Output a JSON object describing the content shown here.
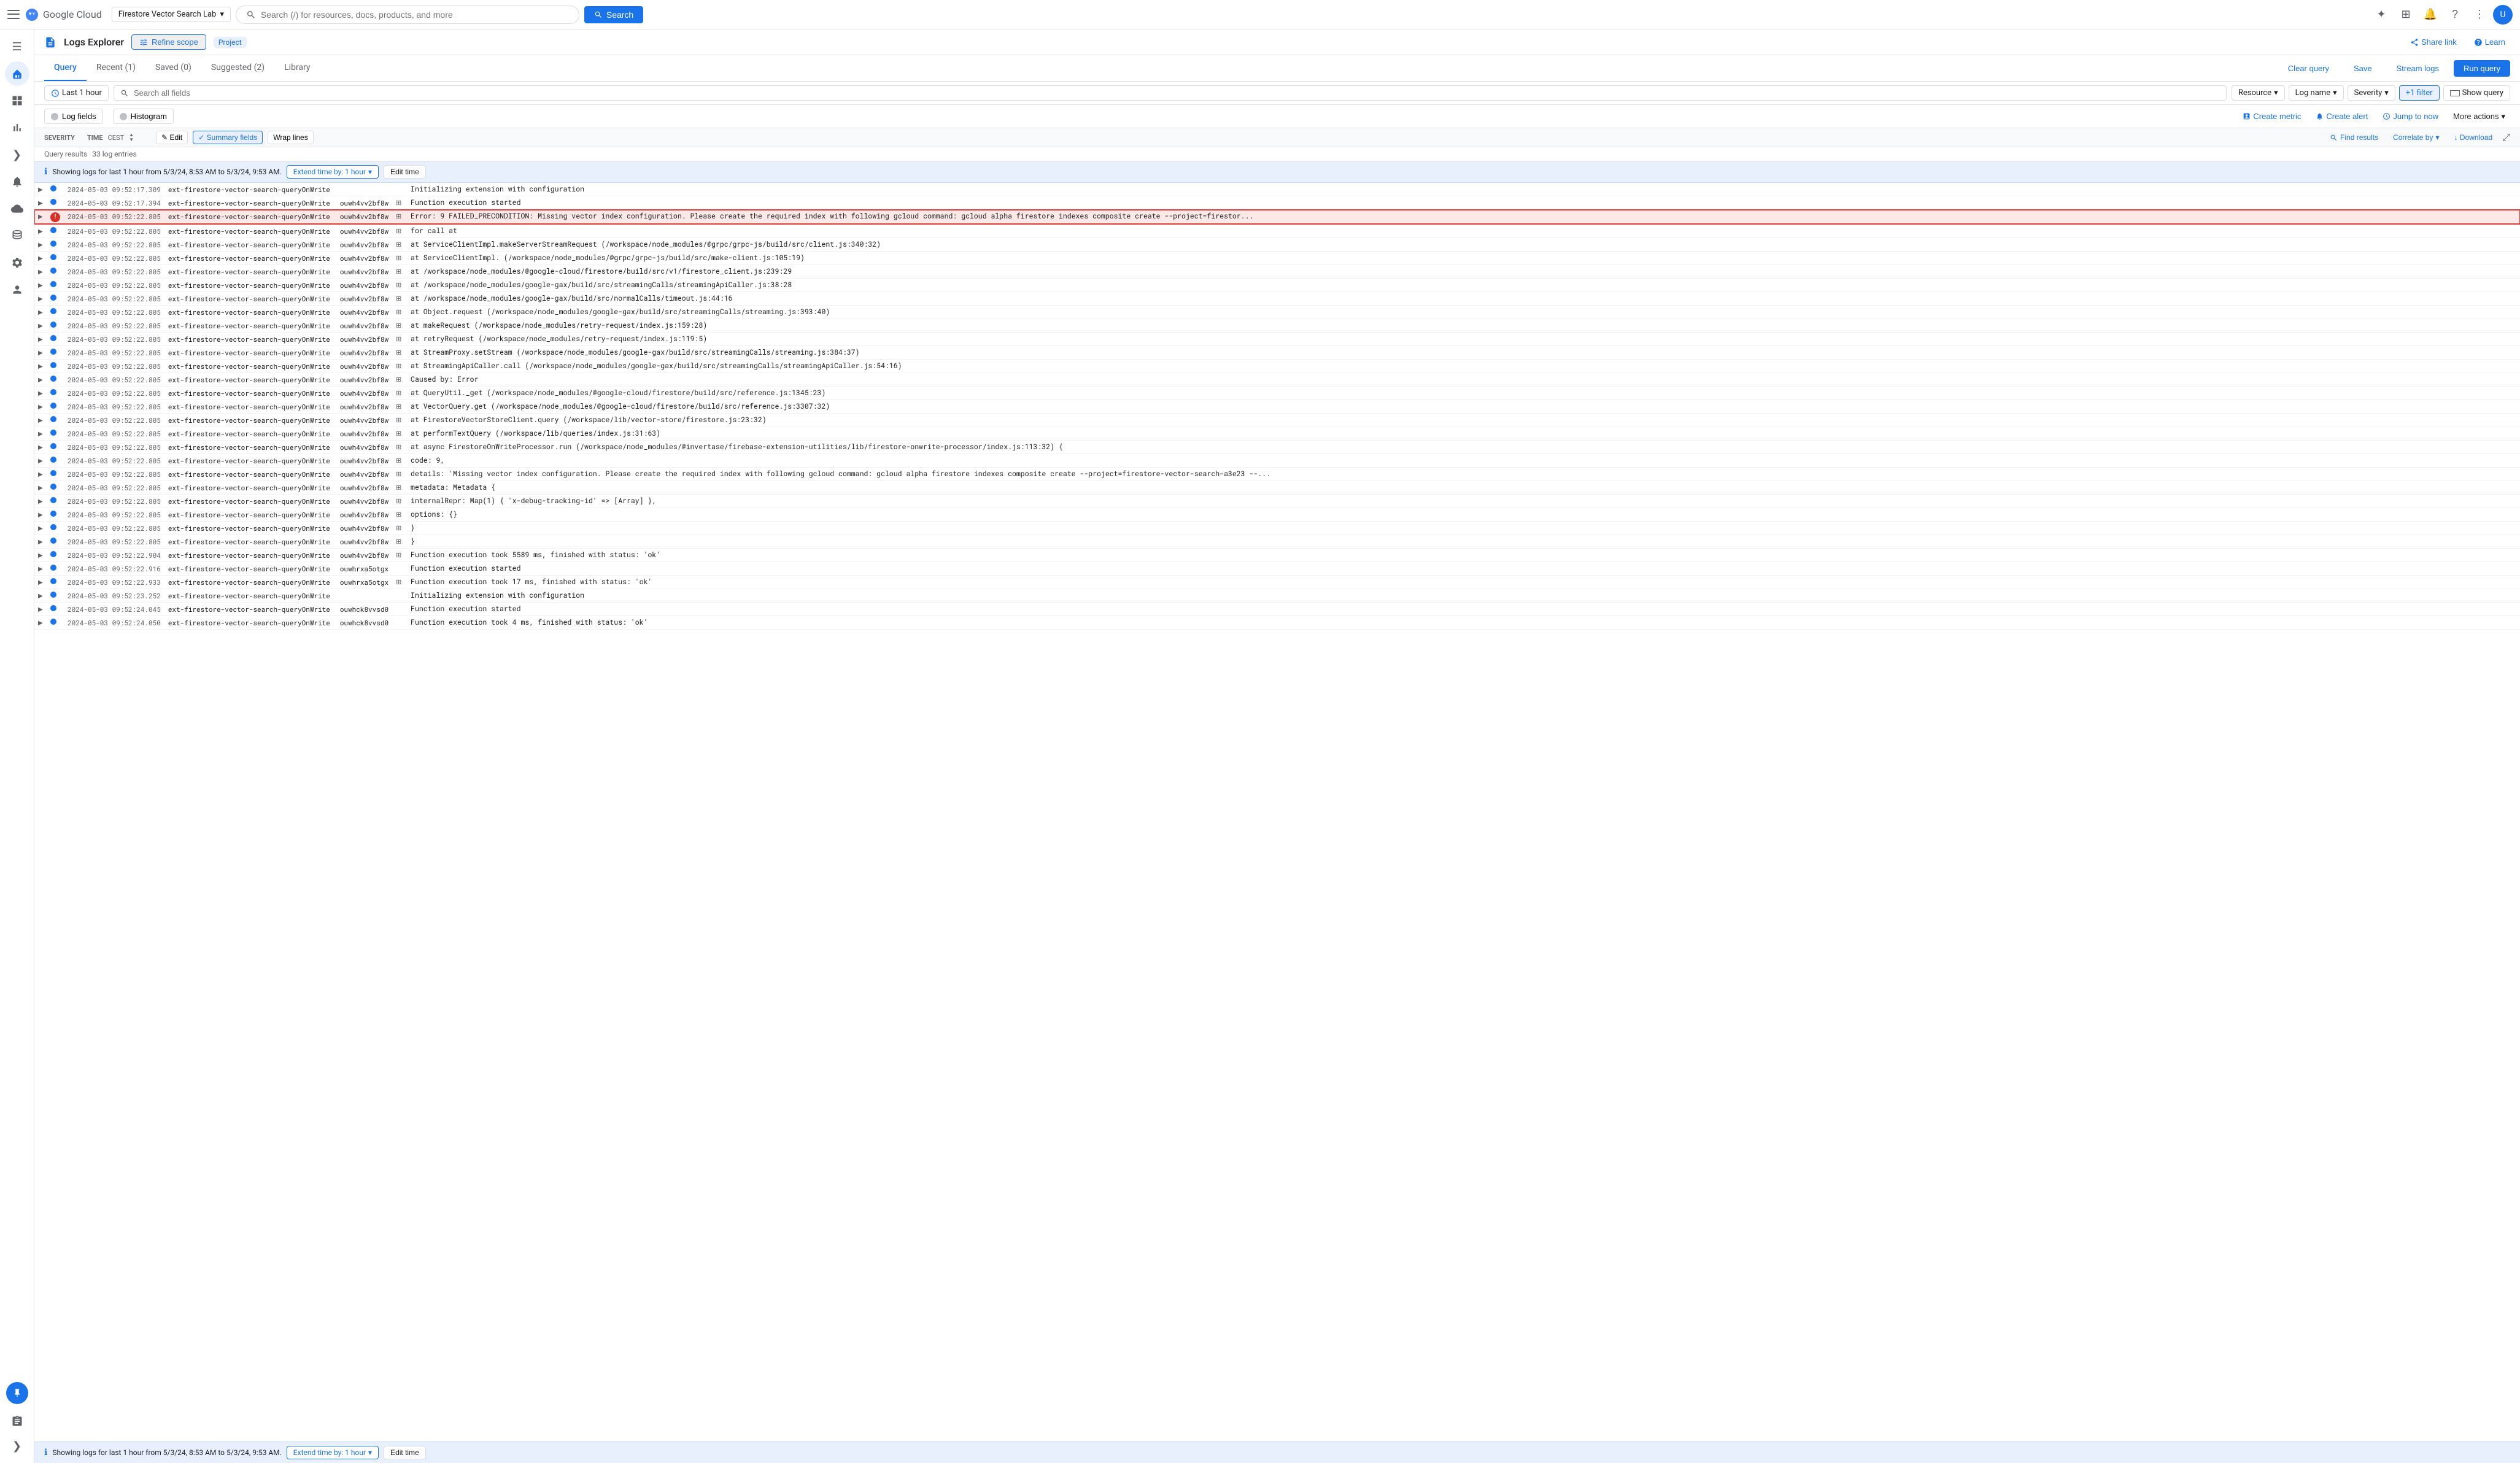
{
  "topNav": {
    "menuIcon": "☰",
    "logoText": "Google Cloud",
    "projectSelector": {
      "label": "Firestore Vector Search Lab",
      "chevron": "▾"
    },
    "searchPlaceholder": "Search (/) for resources, docs, products, and more",
    "searchButton": "Search",
    "navIcons": [
      "✦",
      "⬡",
      "🔔",
      "?",
      "⋮"
    ],
    "avatarText": "U"
  },
  "sidebar": {
    "icons": [
      "☰",
      "⌂",
      "▦",
      "📊",
      "❯",
      "🔔",
      "☁",
      "⚙",
      "⚡",
      "⋮",
      "📋",
      "✂",
      "✕",
      "🔗",
      "⊕"
    ]
  },
  "logsExplorer": {
    "title": "Logs Explorer",
    "refineScopeLabel": "Refine scope",
    "projectBadge": "Project",
    "shareLink": "Share link",
    "learn": "Learn"
  },
  "tabs": {
    "items": [
      {
        "id": "query",
        "label": "Query",
        "active": true
      },
      {
        "id": "recent",
        "label": "Recent (1)",
        "active": false
      },
      {
        "id": "saved",
        "label": "Saved (0)",
        "active": false
      },
      {
        "id": "suggested",
        "label": "Suggested (2)",
        "active": false
      },
      {
        "id": "library",
        "label": "Library",
        "active": false
      }
    ],
    "clearQuery": "Clear query",
    "save": "Save",
    "streamLogs": "Stream logs",
    "runQuery": "Run query"
  },
  "queryBar": {
    "timeLabel": "Last 1 hour",
    "searchPlaceholder": "Search all fields",
    "filters": [
      {
        "id": "resource",
        "label": "Resource"
      },
      {
        "id": "logname",
        "label": "Log name"
      },
      {
        "id": "severity",
        "label": "Severity"
      },
      {
        "id": "plusfilter",
        "label": "+1 filter"
      }
    ],
    "showQuery": "Show query"
  },
  "vizBar": {
    "logFieldsBtn": "Log fields",
    "histogramBtn": "Histogram",
    "createMetric": "Create metric",
    "createAlert": "Create alert",
    "jumpToNow": "Jump to now",
    "moreActions": "More actions"
  },
  "resultsHeader": {
    "severityCol": "SEVERITY",
    "timeCol": "TIME",
    "timeSortLabel": "CEST",
    "summaryBtn": "✎ Edit",
    "summaryFieldsLabel": "✓ Summary fields",
    "wrapLinesLabel": "Wrap lines",
    "findResults": "Find results",
    "correlateBy": "Correlate by",
    "download": "↓ Download",
    "expandIcon": "⤢"
  },
  "infoBar": {
    "message": "Showing logs for last 1 hour from 5/3/24, 8:53 AM to 5/3/24, 9:53 AM.",
    "extendBtn": "Extend time by: 1 hour",
    "extendChevron": "▾",
    "editTime": "Edit time"
  },
  "queryResults": {
    "label": "Query results",
    "count": "33 log entries"
  },
  "logRows": [
    {
      "id": "row1",
      "expandable": true,
      "severity": "info",
      "time": "2024-05-03  09:52:17.309",
      "resource": "ext-firestore-vector-search-queryOnWrite",
      "instance": "",
      "hasJson": false,
      "message": "Initializing extension with configuration"
    },
    {
      "id": "row2",
      "expandable": true,
      "severity": "info",
      "time": "2024-05-03  09:52:17.394",
      "resource": "ext-firestore-vector-search-queryOnWrite",
      "instance": "ouwh4vv2bf8w",
      "hasJson": true,
      "message": "Function execution started"
    },
    {
      "id": "row3",
      "expandable": true,
      "severity": "error",
      "time": "2024-05-03  09:52:22.805",
      "resource": "ext-firestore-vector-search-queryOnWrite",
      "instance": "ouwh4vv2bf8w",
      "hasJson": true,
      "message": "Error: 9 FAILED_PRECONDITION: Missing vector index configuration. Please create the required index with following gcloud command: gcloud alpha firestore indexes composite create --project=firestor...",
      "highlighted": true,
      "errorIcon": true
    },
    {
      "id": "row4",
      "expandable": true,
      "severity": "info",
      "time": "2024-05-03  09:52:22.805",
      "resource": "ext-firestore-vector-search-queryOnWrite",
      "instance": "ouwh4vv2bf8w",
      "hasJson": true,
      "message": "for call at"
    },
    {
      "id": "row5",
      "expandable": true,
      "severity": "info",
      "time": "2024-05-03  09:52:22.805",
      "resource": "ext-firestore-vector-search-queryOnWrite",
      "instance": "ouwh4vv2bf8w",
      "hasJson": true,
      "message": "    at ServiceClientImpl.makeServerStreamRequest (/workspace/node_modules/@grpc/grpc-js/build/src/client.js:340:32)"
    },
    {
      "id": "row6",
      "expandable": true,
      "severity": "info",
      "time": "2024-05-03  09:52:22.805",
      "resource": "ext-firestore-vector-search-queryOnWrite",
      "instance": "ouwh4vv2bf8w",
      "hasJson": true,
      "message": "    at ServiceClientImpl.<anonymous> (/workspace/node_modules/@grpc/grpc-js/build/src/make-client.js:105:19)"
    },
    {
      "id": "row7",
      "expandable": true,
      "severity": "info",
      "time": "2024-05-03  09:52:22.805",
      "resource": "ext-firestore-vector-search-queryOnWrite",
      "instance": "ouwh4vv2bf8w",
      "hasJson": true,
      "message": "    at /workspace/node_modules/@google-cloud/firestore/build/src/v1/firestore_client.js:239:29"
    },
    {
      "id": "row8",
      "expandable": true,
      "severity": "info",
      "time": "2024-05-03  09:52:22.805",
      "resource": "ext-firestore-vector-search-queryOnWrite",
      "instance": "ouwh4vv2bf8w",
      "hasJson": true,
      "message": "    at /workspace/node_modules/google-gax/build/src/streamingCalls/streamingApiCaller.js:38:28"
    },
    {
      "id": "row9",
      "expandable": true,
      "severity": "info",
      "time": "2024-05-03  09:52:22.805",
      "resource": "ext-firestore-vector-search-queryOnWrite",
      "instance": "ouwh4vv2bf8w",
      "hasJson": true,
      "message": "    at /workspace/node_modules/google-gax/build/src/normalCalls/timeout.js:44:16"
    },
    {
      "id": "row10",
      "expandable": true,
      "severity": "info",
      "time": "2024-05-03  09:52:22.805",
      "resource": "ext-firestore-vector-search-queryOnWrite",
      "instance": "ouwh4vv2bf8w",
      "hasJson": true,
      "message": "    at Object.request (/workspace/node_modules/google-gax/build/src/streamingCalls/streaming.js:393:40)"
    },
    {
      "id": "row11",
      "expandable": true,
      "severity": "info",
      "time": "2024-05-03  09:52:22.805",
      "resource": "ext-firestore-vector-search-queryOnWrite",
      "instance": "ouwh4vv2bf8w",
      "hasJson": true,
      "message": "    at makeRequest (/workspace/node_modules/retry-request/index.js:159:28)"
    },
    {
      "id": "row12",
      "expandable": true,
      "severity": "info",
      "time": "2024-05-03  09:52:22.805",
      "resource": "ext-firestore-vector-search-queryOnWrite",
      "instance": "ouwh4vv2bf8w",
      "hasJson": true,
      "message": "    at retryRequest (/workspace/node_modules/retry-request/index.js:119:5)"
    },
    {
      "id": "row13",
      "expandable": true,
      "severity": "info",
      "time": "2024-05-03  09:52:22.805",
      "resource": "ext-firestore-vector-search-queryOnWrite",
      "instance": "ouwh4vv2bf8w",
      "hasJson": true,
      "message": "    at StreamProxy.setStream (/workspace/node_modules/google-gax/build/src/streamingCalls/streaming.js:384:37)"
    },
    {
      "id": "row14",
      "expandable": true,
      "severity": "info",
      "time": "2024-05-03  09:52:22.805",
      "resource": "ext-firestore-vector-search-queryOnWrite",
      "instance": "ouwh4vv2bf8w",
      "hasJson": true,
      "message": "    at StreamingApiCaller.call (/workspace/node_modules/google-gax/build/src/streamingCalls/streamingApiCaller.js:54:16)"
    },
    {
      "id": "row15",
      "expandable": true,
      "severity": "info",
      "time": "2024-05-03  09:52:22.805",
      "resource": "ext-firestore-vector-search-queryOnWrite",
      "instance": "ouwh4vv2bf8w",
      "hasJson": true,
      "message": "Caused by: Error"
    },
    {
      "id": "row16",
      "expandable": true,
      "severity": "info",
      "time": "2024-05-03  09:52:22.805",
      "resource": "ext-firestore-vector-search-queryOnWrite",
      "instance": "ouwh4vv2bf8w",
      "hasJson": true,
      "message": "    at QueryUtil._get (/workspace/node_modules/@google-cloud/firestore/build/src/reference.js:1345:23)"
    },
    {
      "id": "row17",
      "expandable": true,
      "severity": "info",
      "time": "2024-05-03  09:52:22.805",
      "resource": "ext-firestore-vector-search-queryOnWrite",
      "instance": "ouwh4vv2bf8w",
      "hasJson": true,
      "message": "    at VectorQuery.get (/workspace/node_modules/@google-cloud/firestore/build/src/reference.js:3307:32)"
    },
    {
      "id": "row18",
      "expandable": true,
      "severity": "info",
      "time": "2024-05-03  09:52:22.805",
      "resource": "ext-firestore-vector-search-queryOnWrite",
      "instance": "ouwh4vv2bf8w",
      "hasJson": true,
      "message": "    at FirestoreVectorStoreClient.query (/workspace/lib/vector-store/firestore.js:23:32)"
    },
    {
      "id": "row19",
      "expandable": true,
      "severity": "info",
      "time": "2024-05-03  09:52:22.805",
      "resource": "ext-firestore-vector-search-queryOnWrite",
      "instance": "ouwh4vv2bf8w",
      "hasJson": true,
      "message": "    at performTextQuery (/workspace/lib/queries/index.js:31:63)"
    },
    {
      "id": "row20",
      "expandable": true,
      "severity": "info",
      "time": "2024-05-03  09:52:22.805",
      "resource": "ext-firestore-vector-search-queryOnWrite",
      "instance": "ouwh4vv2bf8w",
      "hasJson": true,
      "message": "    at async FirestoreOnWriteProcessor.run (/workspace/node_modules/@invertase/firebase-extension-utilities/lib/firestore-onwrite-processor/index.js:113:32) {"
    },
    {
      "id": "row21",
      "expandable": true,
      "severity": "info",
      "time": "2024-05-03  09:52:22.805",
      "resource": "ext-firestore-vector-search-queryOnWrite",
      "instance": "ouwh4vv2bf8w",
      "hasJson": true,
      "message": "  code: 9,"
    },
    {
      "id": "row22",
      "expandable": true,
      "severity": "info",
      "time": "2024-05-03  09:52:22.805",
      "resource": "ext-firestore-vector-search-queryOnWrite",
      "instance": "ouwh4vv2bf8w",
      "hasJson": true,
      "message": "  details: 'Missing vector index configuration. Please create the required index with following gcloud command: gcloud alpha firestore indexes composite create --project=firestore-vector-search-a3e23 --..."
    },
    {
      "id": "row23",
      "expandable": true,
      "severity": "info",
      "time": "2024-05-03  09:52:22.805",
      "resource": "ext-firestore-vector-search-queryOnWrite",
      "instance": "ouwh4vv2bf8w",
      "hasJson": true,
      "message": "  metadata: Metadata {"
    },
    {
      "id": "row24",
      "expandable": true,
      "severity": "info",
      "time": "2024-05-03  09:52:22.805",
      "resource": "ext-firestore-vector-search-queryOnWrite",
      "instance": "ouwh4vv2bf8w",
      "hasJson": true,
      "message": "    internalRepr: Map(1) { 'x-debug-tracking-id' => [Array] },"
    },
    {
      "id": "row25",
      "expandable": true,
      "severity": "info",
      "time": "2024-05-03  09:52:22.805",
      "resource": "ext-firestore-vector-search-queryOnWrite",
      "instance": "ouwh4vv2bf8w",
      "hasJson": true,
      "message": "    options: {}"
    },
    {
      "id": "row26",
      "expandable": true,
      "severity": "info",
      "time": "2024-05-03  09:52:22.805",
      "resource": "ext-firestore-vector-search-queryOnWrite",
      "instance": "ouwh4vv2bf8w",
      "hasJson": true,
      "message": "  }"
    },
    {
      "id": "row27",
      "expandable": true,
      "severity": "info",
      "time": "2024-05-03  09:52:22.805",
      "resource": "ext-firestore-vector-search-queryOnWrite",
      "instance": "ouwh4vv2bf8w",
      "hasJson": true,
      "message": "}"
    },
    {
      "id": "row28",
      "expandable": true,
      "severity": "info",
      "time": "2024-05-03  09:52:22.904",
      "resource": "ext-firestore-vector-search-queryOnWrite",
      "instance": "ouwh4vv2bf8w",
      "hasJson": true,
      "message": "Function execution took 5589 ms, finished with status: 'ok'"
    },
    {
      "id": "row29",
      "expandable": true,
      "severity": "info",
      "time": "2024-05-03  09:52:22.916",
      "resource": "ext-firestore-vector-search-queryOnWrite",
      "instance": "ouwhrxa5otgx",
      "hasJson": false,
      "message": "Function execution started"
    },
    {
      "id": "row30",
      "expandable": true,
      "severity": "info",
      "time": "2024-05-03  09:52:22.933",
      "resource": "ext-firestore-vector-search-queryOnWrite",
      "instance": "ouwhrxa5otgx",
      "hasJson": true,
      "message": "Function execution took 17 ms, finished with status: 'ok'"
    },
    {
      "id": "row31",
      "expandable": true,
      "severity": "info",
      "time": "2024-05-03  09:52:23.252",
      "resource": "ext-firestore-vector-search-queryOnWrite",
      "instance": "",
      "hasJson": false,
      "message": "Initializing extension with configuration"
    },
    {
      "id": "row32",
      "expandable": true,
      "severity": "info",
      "time": "2024-05-03  09:52:24.045",
      "resource": "ext-firestore-vector-search-queryOnWrite",
      "instance": "ouwhck8vvsd0",
      "hasJson": false,
      "message": "Function execution started"
    },
    {
      "id": "row33",
      "expandable": true,
      "severity": "info",
      "time": "2024-05-03  09:52:24.050",
      "resource": "ext-firestore-vector-search-queryOnWrite",
      "instance": "ouwhck8vvsd0",
      "hasJson": false,
      "message": "Function execution took 4 ms, finished with status: 'ok'"
    }
  ],
  "bottomInfoBar": {
    "message": "Showing logs for last 1 hour from 5/3/24, 8:53 AM to 5/3/24, 9:53 AM.",
    "extendBtn": "Extend time by: 1 hour",
    "editTime": "Edit time"
  },
  "colors": {
    "accent": "#1a73e8",
    "error": "#d93025",
    "errorBg": "#fce8e6",
    "infoBg": "#e8f0fe",
    "border": "#e0e0e0",
    "textPrimary": "#202124",
    "textSecondary": "#5f6368"
  }
}
